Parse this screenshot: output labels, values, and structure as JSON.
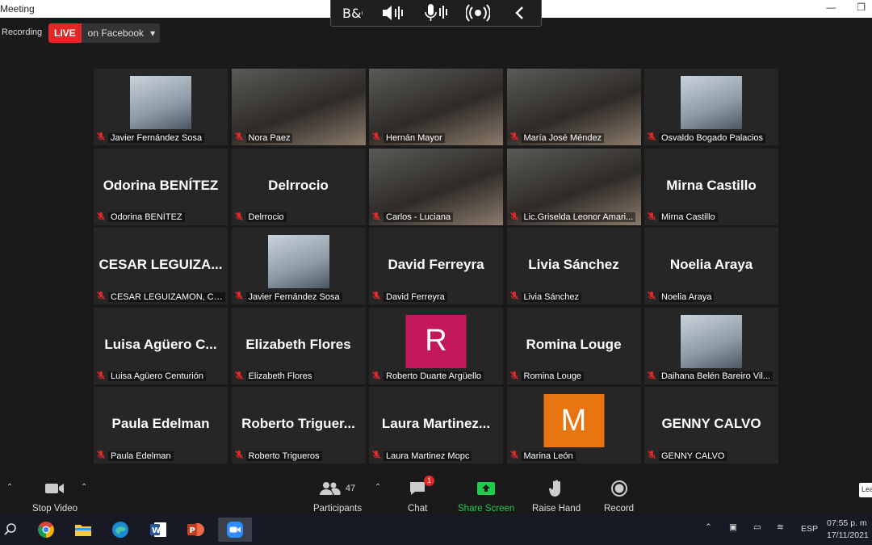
{
  "window": {
    "title": "Meeting"
  },
  "recording": {
    "label": "Recording"
  },
  "live": {
    "badge": "LIVE",
    "destination": "on Facebook"
  },
  "participants": [
    {
      "name": "Javier Fernández Sosa",
      "display": "",
      "kind": "photo"
    },
    {
      "name": "Nora Paez",
      "display": "",
      "kind": "video",
      "active": true
    },
    {
      "name": "Hernán Mayor",
      "display": "",
      "kind": "video"
    },
    {
      "name": "María José Méndez",
      "display": "",
      "kind": "video"
    },
    {
      "name": "Osvaldo Bogado Palacios",
      "display": "",
      "kind": "photo"
    },
    {
      "name": "Odorina BENÍTEZ",
      "display": "Odorina BENÍTEZ",
      "kind": "text"
    },
    {
      "name": "Delrrocio",
      "display": "Delrrocio",
      "kind": "text"
    },
    {
      "name": "Carlos - Luciana",
      "display": "",
      "kind": "video"
    },
    {
      "name": "Lic.Griselda Leonor Amari...",
      "display": "",
      "kind": "video"
    },
    {
      "name": "Mirna Castillo",
      "display": "Mirna Castillo",
      "kind": "text"
    },
    {
      "name": "CESAR LEGUIZAMON, CPC",
      "display": "CESAR  LEGUIZA...",
      "kind": "text"
    },
    {
      "name": "Javier Fernández Sosa",
      "display": "",
      "kind": "photo"
    },
    {
      "name": "David Ferreyra",
      "display": "David Ferreyra",
      "kind": "text"
    },
    {
      "name": "Livia Sánchez",
      "display": "Livia Sánchez",
      "kind": "text"
    },
    {
      "name": "Noelia Araya",
      "display": "Noelia Araya",
      "kind": "text"
    },
    {
      "name": "Luisa Agüero Centurión",
      "display": "Luisa  Agüero  C...",
      "kind": "text"
    },
    {
      "name": "Elizabeth Flores",
      "display": "Elizabeth Flores",
      "kind": "text"
    },
    {
      "name": "Roberto Duarte Argüello",
      "display": "R",
      "kind": "letter",
      "color": "#c2185b"
    },
    {
      "name": "Romina Louge",
      "display": "Romina Louge",
      "kind": "text"
    },
    {
      "name": "Daihana Belén Bareiro Vil...",
      "display": "",
      "kind": "photo"
    },
    {
      "name": "Paula Edelman",
      "display": "Paula Edelman",
      "kind": "text"
    },
    {
      "name": "Roberto Trigueros",
      "display": "Roberto  Triguer...",
      "kind": "text"
    },
    {
      "name": "Laura Martinez Mopc",
      "display": "Laura  Martinez...",
      "kind": "text"
    },
    {
      "name": "Marina León",
      "display": "M",
      "kind": "letter",
      "color": "#e8740f"
    },
    {
      "name": "GENNY CALVO",
      "display": "GENNY CALVO",
      "kind": "text"
    }
  ],
  "toolbar": {
    "stop_video": "Stop Video",
    "participants": "Participants",
    "participants_count": "47",
    "chat": "Chat",
    "chat_badge": "1",
    "share_screen": "Share Screen",
    "raise_hand": "Raise Hand",
    "record": "Record",
    "leave": "Lea"
  },
  "taskbar": {
    "language": "ESP",
    "time": "07:55 p. m",
    "date": "17/11/2021"
  },
  "colors": {
    "accent_green": "#1fcc4c",
    "live_red": "#e02828",
    "active_speaker": "#c6e35a"
  }
}
